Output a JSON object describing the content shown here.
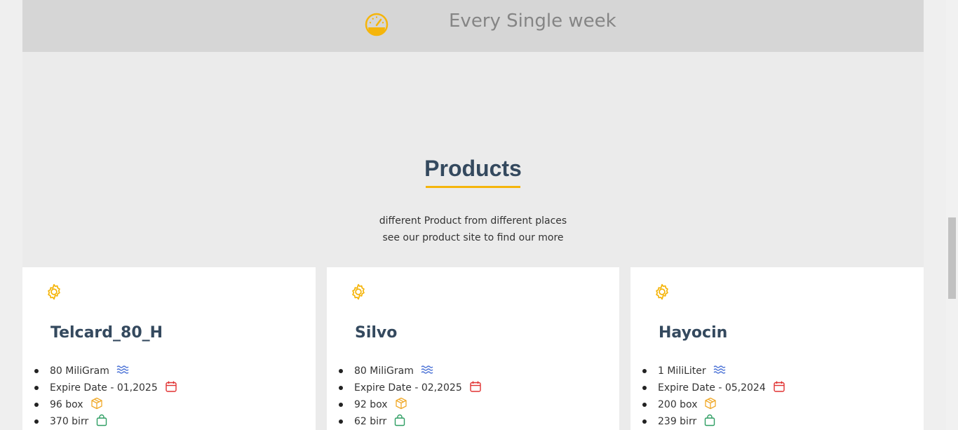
{
  "banner": {
    "icon": "speedometer-icon",
    "text": "Every Single week"
  },
  "section": {
    "title": "Products",
    "subtitle_line1": "different Product from different places",
    "subtitle_line2": "see our product site to find our more"
  },
  "colors": {
    "accent": "#f5b50b",
    "heading": "#34495e",
    "calendar": "#e03131",
    "bag": "#2f9e63",
    "wave": "#4a72d6",
    "box": "#f0a92a"
  },
  "products": [
    {
      "name": "Telcard_80_H",
      "dosage": "80 MiliGram",
      "expire": "Expire Date - 01,2025",
      "quantity": "96 box",
      "price": "370 birr"
    },
    {
      "name": "Silvo",
      "dosage": "80 MiliGram",
      "expire": "Expire Date - 02,2025",
      "quantity": "92 box",
      "price": "62 birr"
    },
    {
      "name": "Hayocin",
      "dosage": "1 MiliLiter",
      "expire": "Expire Date - 05,2024",
      "quantity": "200 box",
      "price": "239 birr"
    }
  ]
}
